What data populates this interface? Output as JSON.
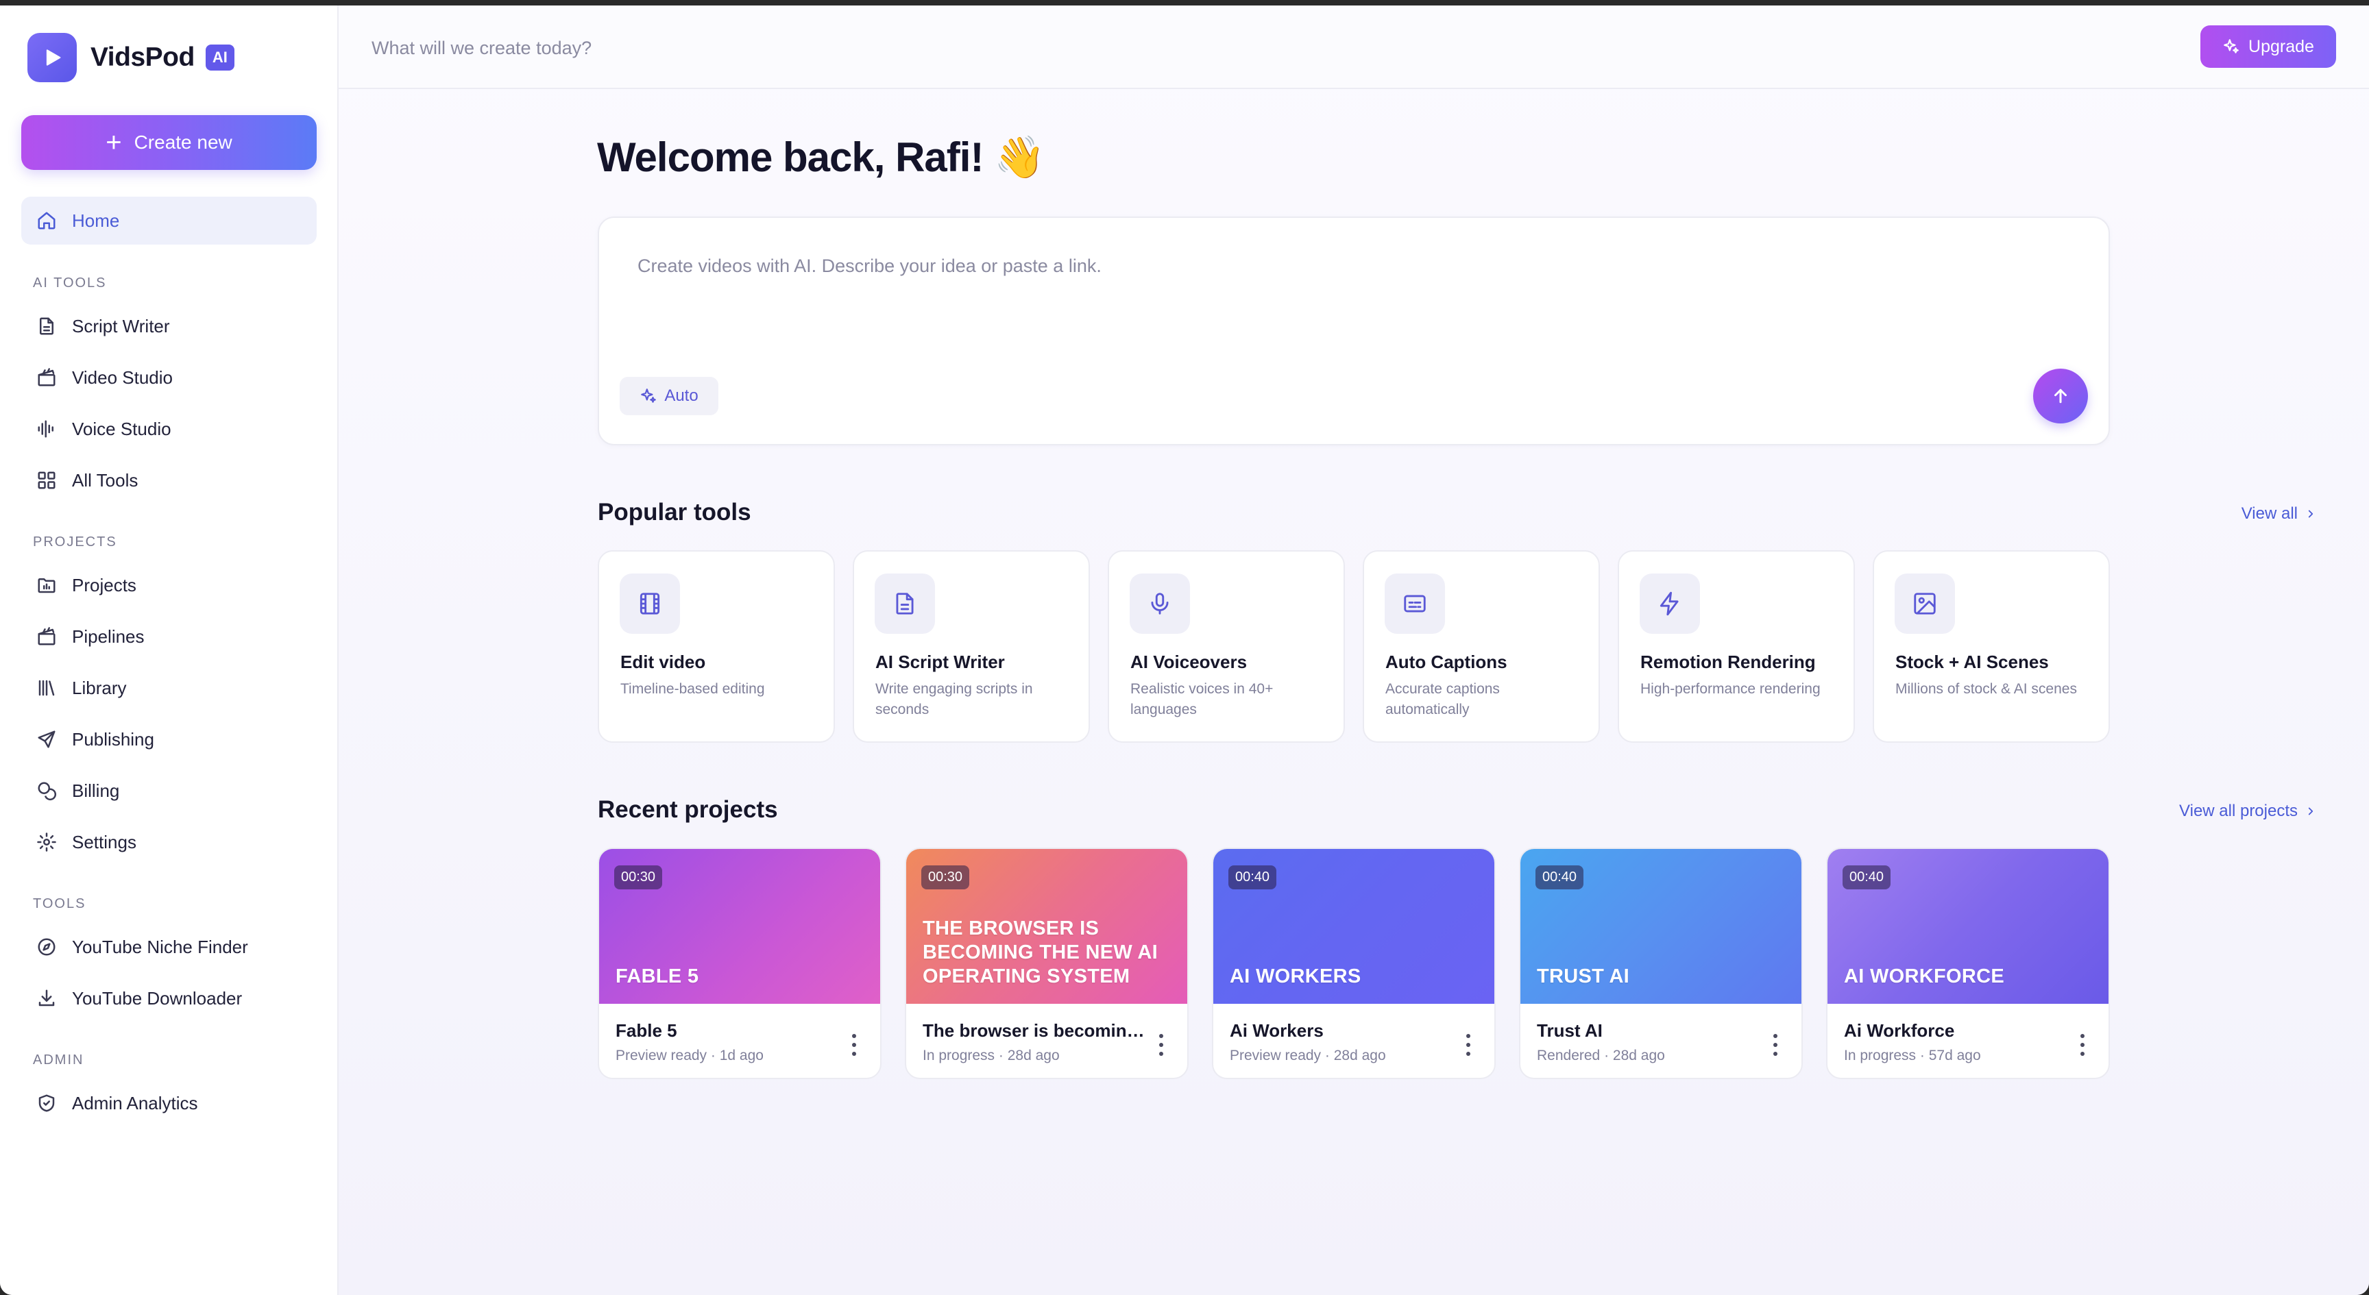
{
  "brand": {
    "name": "VidsPod",
    "badge": "AI"
  },
  "sidebar": {
    "create_label": "Create new",
    "home": "Home",
    "sections": {
      "ai_tools": "AI TOOLS",
      "projects": "PROJECTS",
      "tools": "TOOLS",
      "admin": "ADMIN"
    },
    "ai_tools": [
      "Script Writer",
      "Video Studio",
      "Voice Studio",
      "All Tools"
    ],
    "projects": [
      "Projects",
      "Pipelines",
      "Library",
      "Publishing",
      "Billing",
      "Settings"
    ],
    "tools": [
      "YouTube Niche Finder",
      "YouTube Downloader"
    ],
    "admin": [
      "Admin Analytics"
    ]
  },
  "topbar": {
    "search_placeholder": "What will we create today?",
    "upgrade_label": "Upgrade"
  },
  "main": {
    "welcome": "Welcome back, Rafi! 👋",
    "prompt_placeholder": "Create videos with AI. Describe your idea or paste a link.",
    "auto_label": "Auto",
    "popular_title": "Popular tools",
    "popular_view_all": "View all",
    "recent_title": "Recent projects",
    "recent_view_all": "View all projects"
  },
  "tools": [
    {
      "title": "Edit video",
      "desc": "Timeline-based editing",
      "icon": "film-icon"
    },
    {
      "title": "AI Script Writer",
      "desc": "Write engaging scripts in seconds",
      "icon": "document-icon"
    },
    {
      "title": "AI Voiceovers",
      "desc": "Realistic voices in 40+ languages",
      "icon": "microphone-icon"
    },
    {
      "title": "Auto Captions",
      "desc": "Accurate captions automatically",
      "icon": "captions-icon"
    },
    {
      "title": "Remotion Rendering",
      "desc": "High-performance rendering",
      "icon": "lightning-icon"
    },
    {
      "title": "Stock + AI Scenes",
      "desc": "Millions of stock & AI scenes",
      "icon": "image-icon"
    }
  ],
  "projects": [
    {
      "duration": "00:30",
      "thumb_title": "FABLE 5",
      "name": "Fable 5",
      "meta": "Preview ready · 1d ago"
    },
    {
      "duration": "00:30",
      "thumb_title": "THE BROWSER IS BECOMING THE NEW AI OPERATING SYSTEM",
      "name": "The browser is becoming t...",
      "meta": "In progress · 28d ago"
    },
    {
      "duration": "00:40",
      "thumb_title": "AI WORKERS",
      "name": "Ai Workers",
      "meta": "Preview ready · 28d ago"
    },
    {
      "duration": "00:40",
      "thumb_title": "TRUST AI",
      "name": "Trust AI",
      "meta": "Rendered · 28d ago"
    },
    {
      "duration": "00:40",
      "thumb_title": "AI WORKFORCE",
      "name": "Ai Workforce",
      "meta": "In progress · 57d ago"
    }
  ],
  "colors": {
    "accent": "#4a5bd6",
    "brand_purple": "#6259ea",
    "thumb_gradients": [
      [
        "#9b4fe6",
        "#e060c8"
      ],
      [
        "#f08a5c",
        "#e45cb8"
      ],
      [
        "#5b6cf0",
        "#6a63f3"
      ],
      [
        "#4aa6f0",
        "#5f78f0"
      ],
      [
        "#9d7bf0",
        "#6a5ae8"
      ]
    ]
  }
}
